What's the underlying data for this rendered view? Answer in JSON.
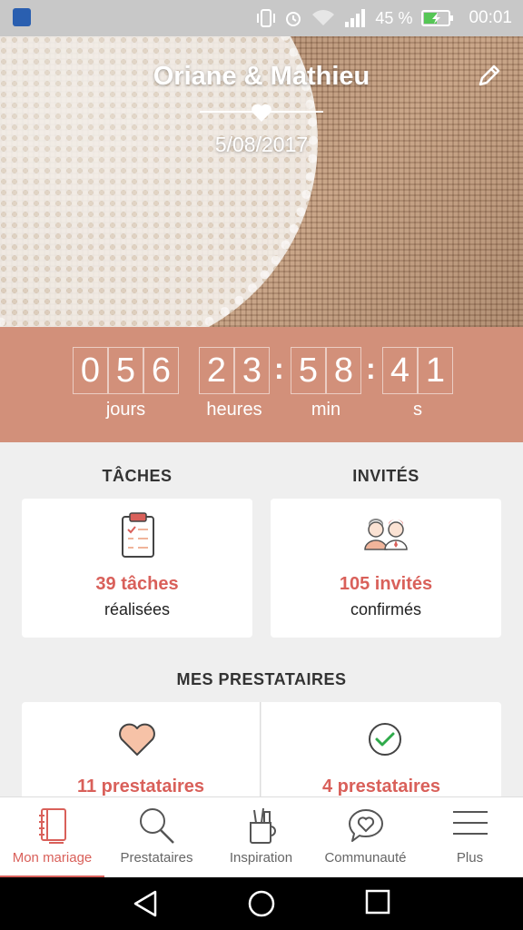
{
  "status_bar": {
    "battery_pct": "45 %",
    "time": "00:01"
  },
  "hero": {
    "title": "Oriane & Mathieu",
    "date": "5/08/2017"
  },
  "countdown": {
    "days": [
      "0",
      "5",
      "6"
    ],
    "hours": [
      "2",
      "3"
    ],
    "minutes": [
      "5",
      "8"
    ],
    "seconds": [
      "4",
      "1"
    ],
    "colon": ":",
    "labels": {
      "days": "jours",
      "hours": "heures",
      "minutes": "min",
      "seconds": "s"
    }
  },
  "tasks": {
    "heading": "TÂCHES",
    "value": "39 tâches",
    "sub": "réalisées"
  },
  "guests": {
    "heading": "INVITÉS",
    "value": "105 invités",
    "sub": "confirmés"
  },
  "vendors": {
    "heading": "MES PRESTATAIRES",
    "left_value": "11 prestataires",
    "right_value": "4 prestataires"
  },
  "bottom_nav": [
    {
      "label": "Mon mariage",
      "icon": "notebook-icon",
      "active": true
    },
    {
      "label": "Prestataires",
      "icon": "search-icon"
    },
    {
      "label": "Inspiration",
      "icon": "pencil-cup-icon"
    },
    {
      "label": "Communauté",
      "icon": "chat-heart-icon"
    },
    {
      "label": "Plus",
      "icon": "menu-icon"
    }
  ],
  "colors": {
    "accent": "#d9605a",
    "countdown_bg": "#d2907a"
  }
}
